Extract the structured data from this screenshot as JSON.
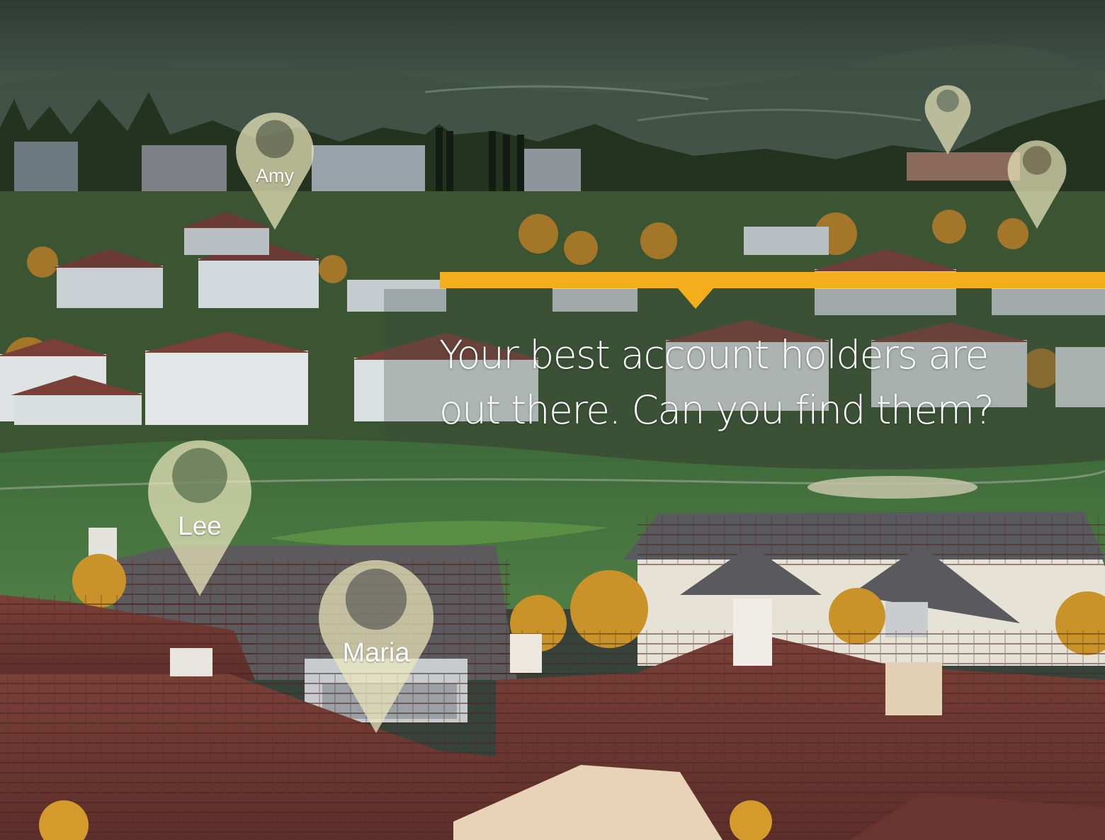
{
  "headline": {
    "line1": "Your best account holders are",
    "line2": "out there. Can you find them?"
  },
  "accent_color": "#f4ae1b",
  "pins": [
    {
      "label": "Amy"
    },
    {
      "label": "Lee"
    },
    {
      "label": "Maria"
    },
    {
      "label": ""
    },
    {
      "label": ""
    }
  ]
}
